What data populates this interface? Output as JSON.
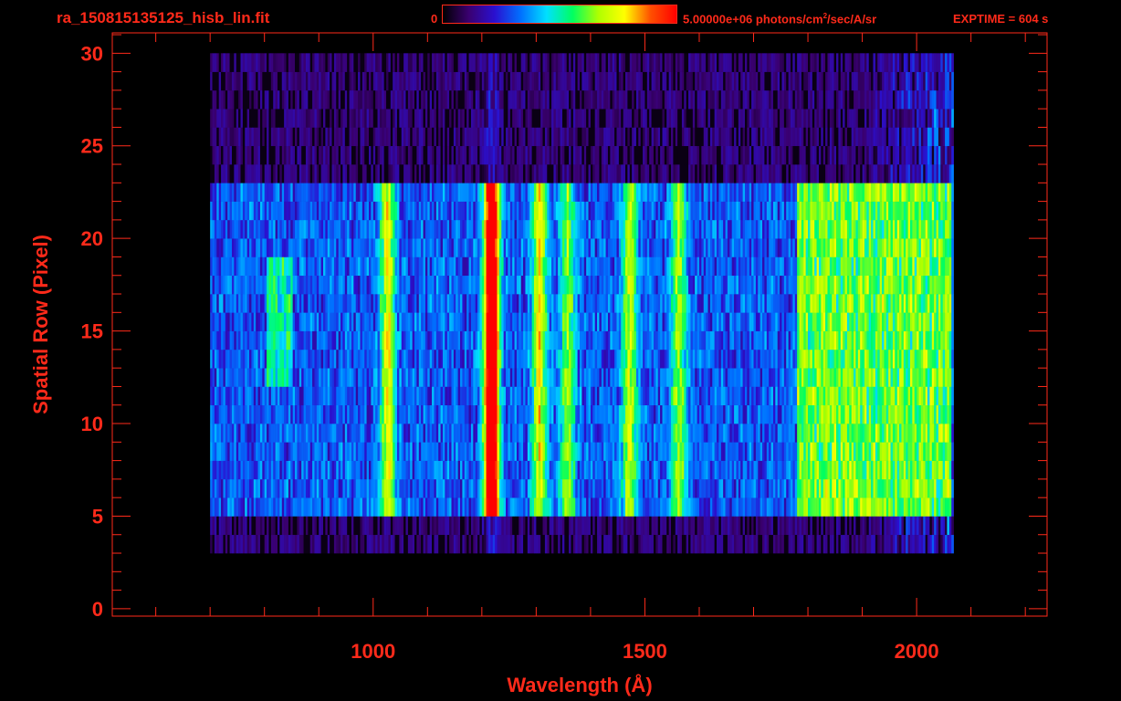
{
  "header": {
    "filename": "ra_150815135125_hisb_lin.fit",
    "colorbar_min": "0",
    "colorbar_max_text": "5.00000e+06 photons/cm²/sec/A/sr",
    "exptime": "EXPTIME = 604 s"
  },
  "colors": {
    "foreground": "#ff2a1a",
    "background": "#000000",
    "colormap": [
      "#000000",
      "#3a0070",
      "#2a10d0",
      "#0070ff",
      "#00e0ff",
      "#00ff60",
      "#b0ff00",
      "#ffff00",
      "#ff5000",
      "#ff0000"
    ]
  },
  "chart_data": {
    "type": "heatmap",
    "xlabel": "Wavelength (Å)",
    "ylabel": "Spatial Row (Pixel)",
    "xlim": [
      520,
      2240
    ],
    "ylim": [
      -0.4,
      31.1
    ],
    "xticks": [
      1000,
      1500,
      2000
    ],
    "yticks": [
      0,
      5,
      10,
      15,
      20,
      25,
      30
    ],
    "x_minor_step": 100,
    "y_minor_step": 1,
    "color_scale": [
      0,
      5000000
    ],
    "color_scale_units": "photons/cm²/sec/A/sr",
    "data_extent": {
      "wavelength": [
        700,
        2065
      ],
      "rows": [
        3,
        30
      ]
    },
    "illuminated_rows": [
      5,
      23
    ],
    "emission_lines": [
      {
        "wavelength": 1025,
        "level": 0.45
      },
      {
        "wavelength": 1216,
        "level": 0.95
      },
      {
        "wavelength": 1304,
        "level": 0.45
      },
      {
        "wavelength": 1356,
        "level": 0.35
      },
      {
        "wavelength": 1470,
        "level": 0.4
      },
      {
        "wavelength": 1560,
        "level": 0.35
      }
    ],
    "continuum": {
      "from": 1780,
      "to": 2060,
      "level": 0.55
    }
  }
}
